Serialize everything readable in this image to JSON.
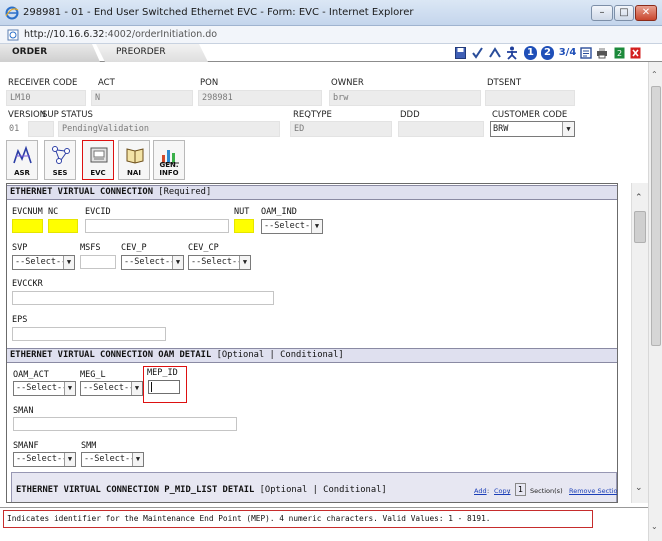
{
  "window": {
    "title": "298981 - 01 - End User Switched Ethernet EVC - Form: EVC - Internet Explorer",
    "url_host": "http://10.16.6.32",
    "url_path": ":4002/orderInitiation.do"
  },
  "tabs": {
    "order": "ORDER",
    "preorder": "PREORDER"
  },
  "toolbar": {
    "one": "1",
    "two": "2",
    "three_four": "3/4"
  },
  "header": {
    "receiver_code_label": "RECEIVER CODE",
    "receiver_code_value": "LM10",
    "act_label": "ACT",
    "act_value": "N",
    "pon_label": "PON",
    "pon_value": "298981",
    "owner_label": "OWNER",
    "owner_value": "brw",
    "dtsent_label": "DTSENT",
    "version_label": "VERSION",
    "version_value": "01",
    "sup_label": "SUP",
    "status_label": "STATUS",
    "status_value": "PendingValidation",
    "reqtype_label": "REQTYPE",
    "reqtype_value": "ED",
    "ddd_label": "DDD",
    "customer_code_label": "CUSTOMER CODE",
    "customer_code_value": "BRW"
  },
  "form_buttons": [
    {
      "label": "ASR"
    },
    {
      "label": "SES"
    },
    {
      "label": "EVC"
    },
    {
      "label": "NAI"
    },
    {
      "label": "GEN. INFO"
    }
  ],
  "evc_section": {
    "title": "ETHERNET VIRTUAL CONNECTION",
    "tag": "[Required]",
    "evcnum": "EVCNUM",
    "nc": "NC",
    "evcid": "EVCID",
    "nut": "NUT",
    "oam_ind": "OAM_IND",
    "svp": "SVP",
    "msfs": "MSFS",
    "cev_p": "CEV_P",
    "cev_cp": "CEV_CP",
    "evcckr": "EVCCKR",
    "eps": "EPS",
    "select_default": "--Select--"
  },
  "oam_section": {
    "title": "ETHERNET VIRTUAL CONNECTION OAM DETAIL",
    "tag": "[Optional | Conditional]",
    "oam_act": "OAM_ACT",
    "meg_l": "MEG_L",
    "mep_id": "MEP_ID",
    "sman": "SMAN",
    "smanf": "SMANF",
    "smm": "SMM"
  },
  "pmid_section": {
    "title": "ETHERNET VIRTUAL CONNECTION P_MID_LIST DETAIL",
    "tag": "[Optional | Conditional]",
    "add": "Add",
    "copy": "Copy",
    "count": "1",
    "sections": "Section(s)",
    "remove": "Remove Section"
  },
  "help_text": "Indicates identifier for the Maintenance End Point (MEP). 4 numeric characters. Valid Values: 1 - 8191."
}
